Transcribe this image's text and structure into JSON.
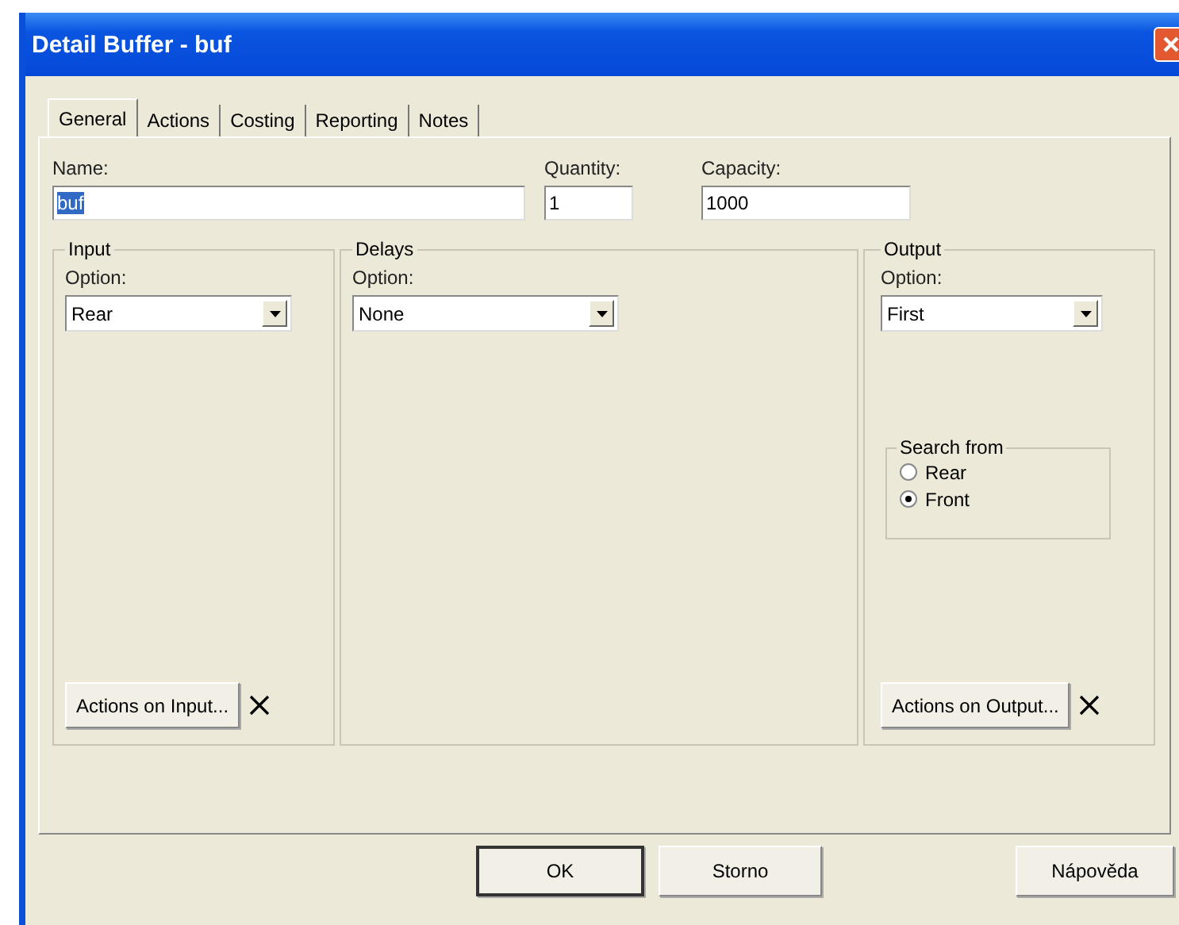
{
  "window": {
    "title": "Detail Buffer - buf"
  },
  "tabs": [
    {
      "label": "General",
      "selected": true
    },
    {
      "label": "Actions",
      "selected": false
    },
    {
      "label": "Costing",
      "selected": false
    },
    {
      "label": "Reporting",
      "selected": false
    },
    {
      "label": "Notes",
      "selected": false
    }
  ],
  "fields": [
    {
      "label": "Name:",
      "value": "buf",
      "text_selected": true
    },
    {
      "label": "Quantity:",
      "value": "1",
      "text_selected": false
    },
    {
      "label": "Capacity:",
      "value": "1000",
      "text_selected": false
    }
  ],
  "groups": [
    {
      "kind": "input",
      "title": "Input",
      "option_label": "Option:",
      "option_value": "Rear",
      "action_button": "Actions on Input..."
    },
    {
      "kind": "delays",
      "title": "Delays",
      "option_label": "Option:",
      "option_value": "None"
    },
    {
      "kind": "output",
      "title": "Output",
      "option_label": "Option:",
      "option_value": "First",
      "action_button": "Actions on Output...",
      "search_from": {
        "title": "Search from",
        "options": [
          {
            "label": "Rear",
            "selected": false
          },
          {
            "label": "Front",
            "selected": true
          }
        ]
      }
    }
  ],
  "buttons": [
    {
      "label": "OK",
      "default": true
    },
    {
      "label": "Storno",
      "default": false
    },
    {
      "label": "Nápověda",
      "default": false
    }
  ]
}
